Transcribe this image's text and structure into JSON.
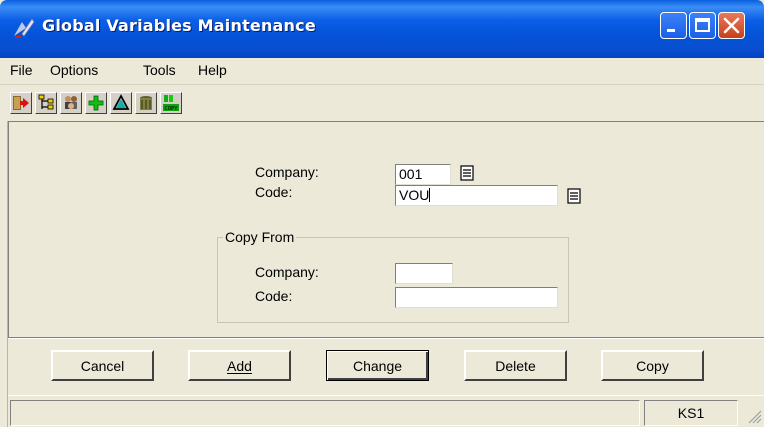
{
  "window": {
    "title": "Global Variables Maintenance"
  },
  "menu": {
    "items": [
      "File",
      "Options",
      "Tools",
      "Help"
    ]
  },
  "toolbar": {
    "buttons": [
      "exit-icon",
      "tree-icon",
      "group-icon",
      "add-plus-icon",
      "delta-icon",
      "trash-icon",
      "copy-icon"
    ],
    "copy_text": "COPY"
  },
  "form": {
    "company_label": "Company:",
    "company_value": "001",
    "code_label": "Code:",
    "code_value": "VOU",
    "copy_from": {
      "legend": "Copy From",
      "company_label": "Company:",
      "company_value": "",
      "code_label": "Code:",
      "code_value": ""
    }
  },
  "buttons": {
    "cancel": "Cancel",
    "add": "Add",
    "change": "Change",
    "delete": "Delete",
    "copy": "Copy"
  },
  "status": {
    "pane_left": "",
    "pane_right": "KS1"
  },
  "colors": {
    "titlebar": "#0453d8",
    "window_bg": "#ece9d8",
    "close_button": "#c7401c"
  }
}
